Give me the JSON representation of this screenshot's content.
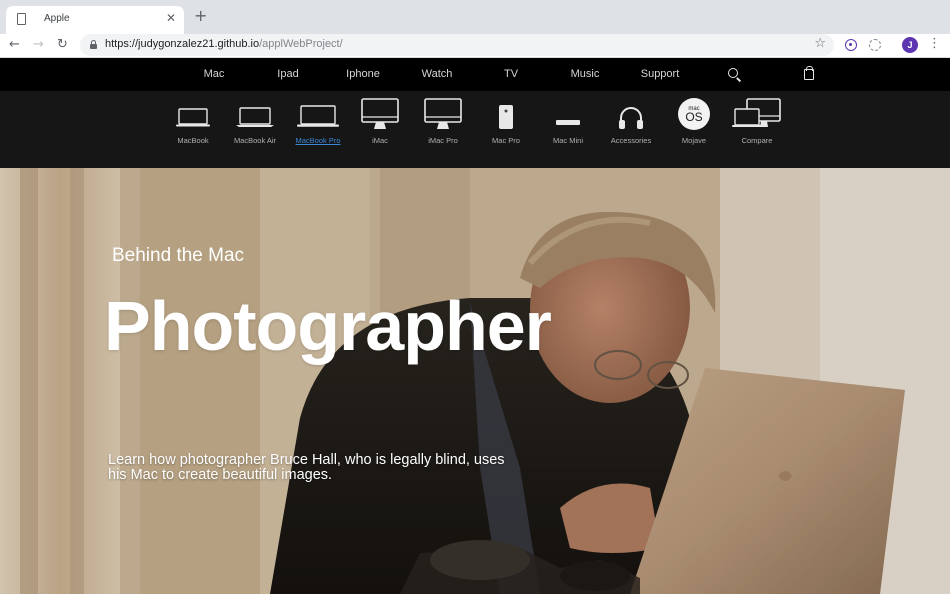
{
  "browser": {
    "tab_title": "Apple",
    "new_tab_symbol": "+",
    "close_symbol": "✕",
    "url_host": "https://judygonzalez21.github.io",
    "url_path": "/applWebProject/",
    "profile_initial": "J",
    "icons": [
      "page-icon",
      "apple-favicon",
      "back-icon",
      "forward-icon",
      "reload-icon",
      "lock-icon",
      "star-icon",
      "extension-icon",
      "menu-icon"
    ]
  },
  "globalnav": {
    "items": [
      "Mac",
      "Ipad",
      "Iphone",
      "Watch",
      "TV",
      "Music",
      "Support"
    ]
  },
  "subnav": {
    "items": [
      {
        "label": "MacBook",
        "icon": "macbook-icon"
      },
      {
        "label": "MacBook Air",
        "icon": "macbook-air-icon"
      },
      {
        "label": "MacBook Pro",
        "icon": "macbook-pro-icon",
        "active": true
      },
      {
        "label": "iMac",
        "icon": "imac-icon"
      },
      {
        "label": "iMac Pro",
        "icon": "imac-pro-icon"
      },
      {
        "label": "Mac Pro",
        "icon": "mac-pro-icon"
      },
      {
        "label": "Mac Mini",
        "icon": "mac-mini-icon"
      },
      {
        "label": "Accessories",
        "icon": "headphones-icon"
      },
      {
        "label": "Mojave",
        "icon": "macos-icon"
      },
      {
        "label": "Compare",
        "icon": "compare-icon"
      }
    ],
    "macos_badge_small": "mac",
    "macos_badge_large": "OS",
    "active_color": "#3a86d8"
  },
  "hero": {
    "eyebrow": "Behind the Mac",
    "title": "Photographer",
    "copy": "Learn how photographer Bruce Hall, who is legally blind, uses his Mac to create beautiful images."
  }
}
